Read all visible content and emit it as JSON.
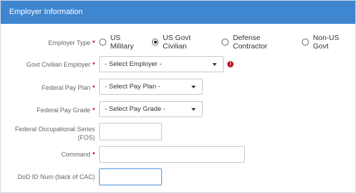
{
  "header": {
    "title": "Employer Information"
  },
  "employer_type": {
    "label": "Employer Type",
    "required_mark": "*",
    "options": [
      {
        "label": "US Military",
        "checked": false
      },
      {
        "label": "US Govt Civilian",
        "checked": true
      },
      {
        "label": "Defense Contractor",
        "checked": false
      },
      {
        "label": "Non-US Govt",
        "checked": false
      }
    ]
  },
  "govt_employer": {
    "label": "Govt Civilian Employer",
    "required_mark": "*",
    "value": "- Select Employer -",
    "error_glyph": "!"
  },
  "pay_plan": {
    "label": "Federal Pay Plan",
    "required_mark": "*",
    "value": "- Select Pay Plan -"
  },
  "pay_grade": {
    "label": "Federal Pay Grade",
    "required_mark": "*",
    "value": "- Select Pay Grade -"
  },
  "fos": {
    "label_line1": "Federal Occupational Series",
    "label_line2": "(FOS)",
    "value": ""
  },
  "command": {
    "label": "Command",
    "required_mark": "*",
    "value": ""
  },
  "dod_id": {
    "label": "DoD ID Num (back of CAC)",
    "value": ""
  },
  "colors": {
    "header_bg": "#3f86d0",
    "required": "#d0021b",
    "error_icon": "#c0141f",
    "focus_border": "#6aa3e0"
  }
}
